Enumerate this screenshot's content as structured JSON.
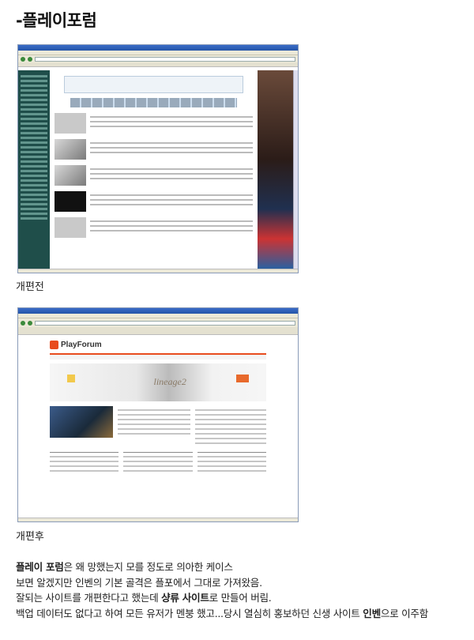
{
  "title": "-플레이포럼",
  "screenshots": [
    {
      "caption": "개편전",
      "alt": "before"
    },
    {
      "caption": "개편후",
      "alt": "after",
      "logo_text": "PlayForum",
      "banner_text": "lineage2"
    }
  ],
  "paragraph": {
    "line1": {
      "bold": "플레이 포럼",
      "rest": "은 왜 망했는지 모를 정도로 의아한 케이스"
    },
    "line2": "보면 알겠지만 인벤의 기본 골격은 플포에서 그대로 가져왔음.",
    "line3": {
      "pre": "잘되는 사이트를 개편한다고 했는데 ",
      "bold": "샹류 사이트",
      "post": "로 만들어 버림."
    },
    "line4": {
      "pre": "백업 데이터도 없다고 하여 모든 유저가 멘붕 했고...당시 열심히 홍보하던 신생 사이트 ",
      "bold": "인벤",
      "post": "으로 이주함"
    }
  },
  "colors": {
    "accent": "#e84c1e",
    "before_sidebar": "#1f4e4a"
  }
}
